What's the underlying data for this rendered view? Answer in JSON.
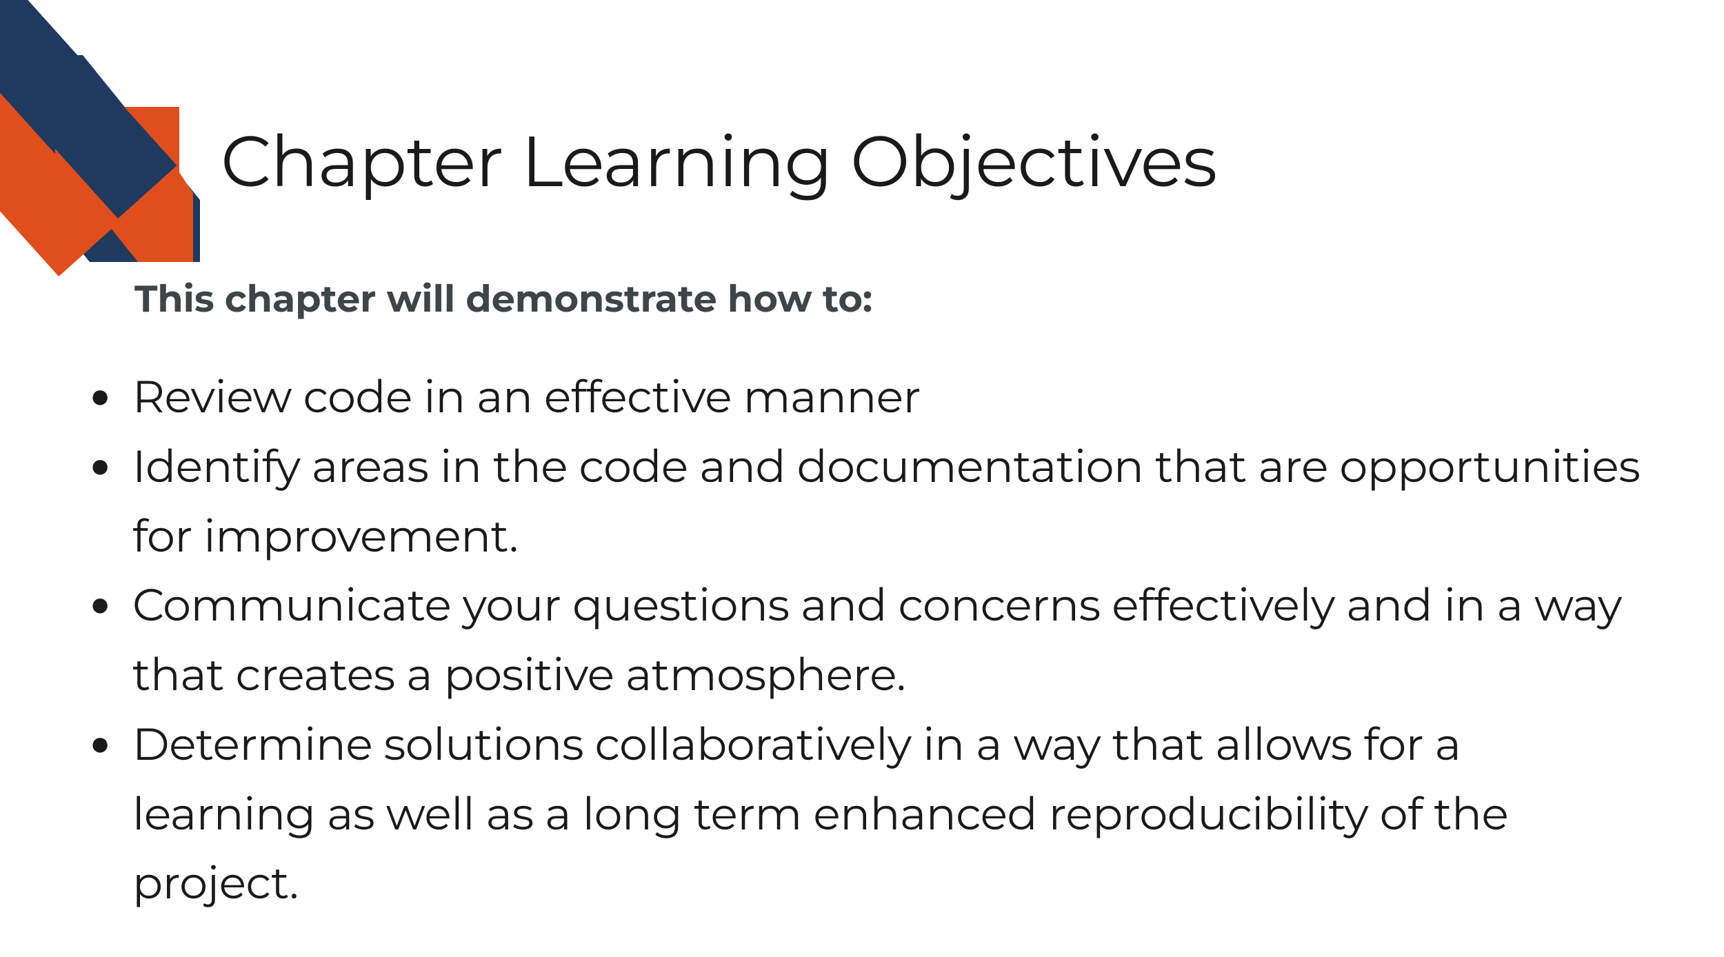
{
  "title": "Chapter Learning Objectives",
  "subtitle": "This chapter will demonstrate how to:",
  "objectives": [
    "Review code in an effective manner",
    "Identify areas in the code and documentation that are opportunities for improvement.",
    "Communicate your questions and concerns effectively and in a way that creates a positive atmosphere.",
    "Determine solutions collaboratively in a way that allows for a learning as well as a long term enhanced reproducibility of the project."
  ],
  "colors": {
    "navy": "#1e3a5f",
    "orange": "#e04e1c",
    "subtitle_gray": "#3d4548"
  }
}
